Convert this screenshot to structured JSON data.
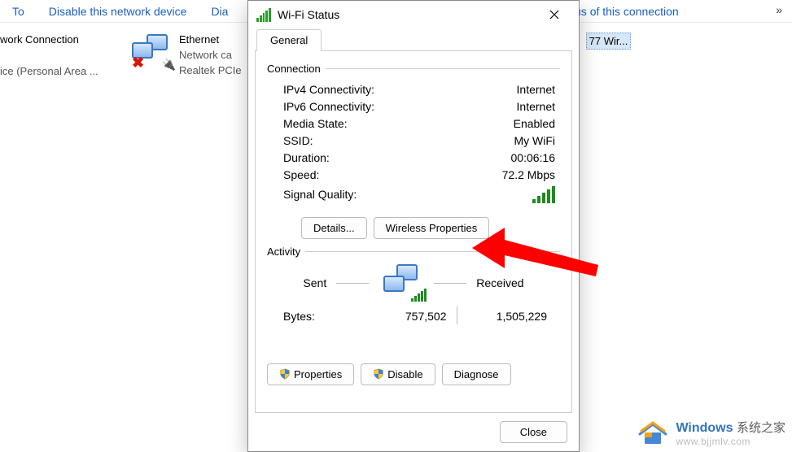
{
  "bg": {
    "toolbar": {
      "to": "To",
      "disable": "Disable this network device",
      "dia": "Dia",
      "status": "tatus of this connection",
      "chev": "»"
    },
    "conn1": {
      "name": "work Connection",
      "line2": "ice (Personal Area ..."
    },
    "conn2": {
      "name": "Ethernet",
      "line2": "Network ca",
      "line3": "Realtek PCIe"
    },
    "wifi_sel": "77 Wir..."
  },
  "dialog": {
    "title": "Wi-Fi Status",
    "tab": "General",
    "connection": {
      "head": "Connection",
      "ipv4_l": "IPv4 Connectivity:",
      "ipv4_v": "Internet",
      "ipv6_l": "IPv6 Connectivity:",
      "ipv6_v": "Internet",
      "media_l": "Media State:",
      "media_v": "Enabled",
      "ssid_l": "SSID:",
      "ssid_v": "My WiFi",
      "dur_l": "Duration:",
      "dur_v": "00:06:16",
      "speed_l": "Speed:",
      "speed_v": "72.2 Mbps",
      "sigq_l": "Signal Quality:"
    },
    "btn_details": "Details...",
    "btn_wprops": "Wireless Properties",
    "activity": {
      "head": "Activity",
      "sent": "Sent",
      "recv": "Received",
      "bytes_l": "Bytes:",
      "bytes_sent": "757,502",
      "bytes_recv": "1,505,229"
    },
    "btn_props": "Properties",
    "btn_disable": "Disable",
    "btn_diag": "Diagnose",
    "btn_close": "Close"
  },
  "watermark": {
    "brand": "Windows",
    "cn": "系统之家",
    "url": "www.bjjmlv.com"
  }
}
